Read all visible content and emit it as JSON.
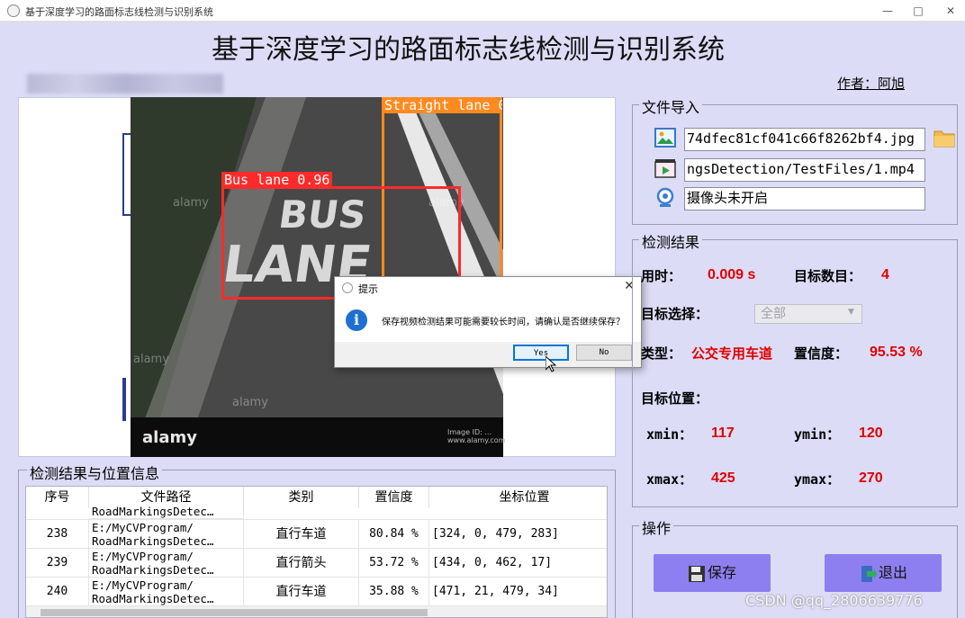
{
  "window": {
    "title": "基于深度学习的路面标志线检测与识别系统",
    "controls": {
      "minimize": "—",
      "maximize": "□",
      "close": "✕"
    }
  },
  "header": {
    "title": "基于深度学习的路面标志线检测与识别系统",
    "author": "作者：阿旭"
  },
  "image": {
    "detections": [
      {
        "label": "Straight lane 0",
        "color": "#ff8a1f"
      },
      {
        "label": "Bus lane 0.96",
        "color": "#ff2a2a"
      }
    ],
    "road_text": [
      "BUS",
      "LANE"
    ],
    "watermarks": [
      "alamy",
      "alamy",
      "alamy",
      "alamy"
    ],
    "footer_logo": "alamy",
    "footer_small": [
      "Image ID: ...",
      "www.alamy.com"
    ]
  },
  "dialog": {
    "title": "提示",
    "message": "保存视频检测结果可能需要较长时间，请确认是否继续保存？",
    "yes_label": "Yes",
    "no_label": "No",
    "close": "✕",
    "info_icon": "i"
  },
  "file_import": {
    "title": "文件导入",
    "image_path": "74dfec81cf041c66f8262bf4.jpg",
    "video_path": "ngsDetection/TestFiles/1.mp4",
    "camera_status": "摄像头未开启",
    "icons": [
      "image-icon",
      "video-icon",
      "camera-icon",
      "folder-icon"
    ]
  },
  "results": {
    "title": "检测结果",
    "time_label": "用时：",
    "time_value": "0.009 s",
    "count_label": "目标数目：",
    "count_value": "4",
    "select_label": "目标选择：",
    "select_value": "全部",
    "type_label": "类型：",
    "type_value": "公交专用车道",
    "conf_label": "置信度：",
    "conf_value": "95.53 %",
    "position_label": "目标位置：",
    "xmin_label": "xmin：",
    "xmin_value": "117",
    "ymin_label": "ymin：",
    "ymin_value": "120",
    "xmax_label": "xmax：",
    "xmax_value": "425",
    "ymax_label": "ymax：",
    "ymax_value": "270"
  },
  "actions": {
    "title": "操作",
    "save_label": "保存",
    "exit_label": "退出"
  },
  "table": {
    "title": "检测结果与位置信息",
    "headers": [
      "序号",
      "文件路径",
      "类别",
      "置信度",
      "坐标位置"
    ],
    "partial_row": {
      "path": "RoadMarkingsDetec…"
    },
    "rows": [
      {
        "id": "238",
        "path1": "E:/MyCVProgram/",
        "path2": "RoadMarkingsDetec…",
        "cls": "直行车道",
        "conf": "80.84 %",
        "coord": "[324, 0, 479, 283]"
      },
      {
        "id": "239",
        "path1": "E:/MyCVProgram/",
        "path2": "RoadMarkingsDetec…",
        "cls": "直行箭头",
        "conf": "53.72 %",
        "coord": "[434, 0, 462, 17]"
      },
      {
        "id": "240",
        "path1": "E:/MyCVProgram/",
        "path2": "RoadMarkingsDetec…",
        "cls": "直行车道",
        "conf": "35.88 %",
        "coord": "[471, 21, 479, 34]"
      }
    ]
  },
  "csdn_watermark": "CSDN @qq_2806639776"
}
